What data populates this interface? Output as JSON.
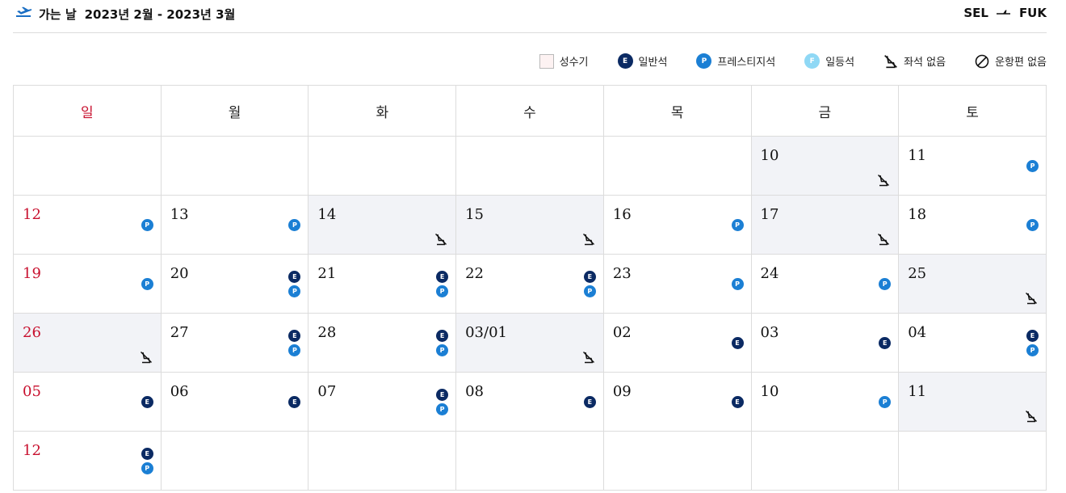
{
  "header": {
    "label": "가는 날",
    "period": "2023년 2월 - 2023년 3월",
    "origin": "SEL",
    "destination": "FUK"
  },
  "legend": {
    "peak": "성수기",
    "economy": "일반석",
    "economy_letter": "E",
    "prestige": "프레스티지석",
    "prestige_letter": "P",
    "first": "일등석",
    "first_letter": "F",
    "no_seat": "좌석 없음",
    "no_flight": "운항편 없음"
  },
  "colors": {
    "economy": "#0b2a63",
    "prestige": "#1b7fd4",
    "first": "#8fd8f5",
    "sunday": "#c8102e",
    "unavailable_bg": "#f2f3f7",
    "peak_bg": "#fdf2f2"
  },
  "weekdays": [
    "일",
    "월",
    "화",
    "수",
    "목",
    "금",
    "토"
  ],
  "weeks": [
    [
      {
        "date": "",
        "classes": [],
        "no_seat": false
      },
      {
        "date": "",
        "classes": [],
        "no_seat": false
      },
      {
        "date": "",
        "classes": [],
        "no_seat": false
      },
      {
        "date": "",
        "classes": [],
        "no_seat": false
      },
      {
        "date": "",
        "classes": [],
        "no_seat": false
      },
      {
        "date": "10",
        "classes": [],
        "no_seat": true
      },
      {
        "date": "11",
        "classes": [
          "P"
        ],
        "no_seat": false
      }
    ],
    [
      {
        "date": "12",
        "classes": [
          "P"
        ],
        "no_seat": false
      },
      {
        "date": "13",
        "classes": [
          "P"
        ],
        "no_seat": false
      },
      {
        "date": "14",
        "classes": [],
        "no_seat": true
      },
      {
        "date": "15",
        "classes": [],
        "no_seat": true
      },
      {
        "date": "16",
        "classes": [
          "P"
        ],
        "no_seat": false
      },
      {
        "date": "17",
        "classes": [],
        "no_seat": true
      },
      {
        "date": "18",
        "classes": [
          "P"
        ],
        "no_seat": false
      }
    ],
    [
      {
        "date": "19",
        "classes": [
          "P"
        ],
        "no_seat": false
      },
      {
        "date": "20",
        "classes": [
          "E",
          "P"
        ],
        "no_seat": false
      },
      {
        "date": "21",
        "classes": [
          "E",
          "P"
        ],
        "no_seat": false
      },
      {
        "date": "22",
        "classes": [
          "E",
          "P"
        ],
        "no_seat": false
      },
      {
        "date": "23",
        "classes": [
          "P"
        ],
        "no_seat": false
      },
      {
        "date": "24",
        "classes": [
          "P"
        ],
        "no_seat": false
      },
      {
        "date": "25",
        "classes": [],
        "no_seat": true
      }
    ],
    [
      {
        "date": "26",
        "classes": [],
        "no_seat": true
      },
      {
        "date": "27",
        "classes": [
          "E",
          "P"
        ],
        "no_seat": false
      },
      {
        "date": "28",
        "classes": [
          "E",
          "P"
        ],
        "no_seat": false
      },
      {
        "date": "03/01",
        "classes": [],
        "no_seat": true
      },
      {
        "date": "02",
        "classes": [
          "E"
        ],
        "no_seat": false
      },
      {
        "date": "03",
        "classes": [
          "E"
        ],
        "no_seat": false
      },
      {
        "date": "04",
        "classes": [
          "E",
          "P"
        ],
        "no_seat": false
      }
    ],
    [
      {
        "date": "05",
        "classes": [
          "E"
        ],
        "no_seat": false
      },
      {
        "date": "06",
        "classes": [
          "E"
        ],
        "no_seat": false
      },
      {
        "date": "07",
        "classes": [
          "E",
          "P"
        ],
        "no_seat": false
      },
      {
        "date": "08",
        "classes": [
          "E"
        ],
        "no_seat": false
      },
      {
        "date": "09",
        "classes": [
          "E"
        ],
        "no_seat": false
      },
      {
        "date": "10",
        "classes": [
          "P"
        ],
        "no_seat": false
      },
      {
        "date": "11",
        "classes": [],
        "no_seat": true
      }
    ],
    [
      {
        "date": "12",
        "classes": [
          "E",
          "P"
        ],
        "no_seat": false
      },
      {
        "date": "",
        "classes": [],
        "no_seat": false
      },
      {
        "date": "",
        "classes": [],
        "no_seat": false
      },
      {
        "date": "",
        "classes": [],
        "no_seat": false
      },
      {
        "date": "",
        "classes": [],
        "no_seat": false
      },
      {
        "date": "",
        "classes": [],
        "no_seat": false
      },
      {
        "date": "",
        "classes": [],
        "no_seat": false
      }
    ]
  ]
}
